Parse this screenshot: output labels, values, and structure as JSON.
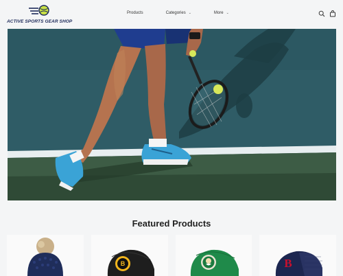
{
  "header": {
    "logo_text": "ACTIVE SPORTS GEAR SHOP",
    "nav": [
      {
        "label": "Products",
        "has_dropdown": false
      },
      {
        "label": "Categories",
        "has_dropdown": true
      },
      {
        "label": "More",
        "has_dropdown": true
      }
    ],
    "icons": [
      "search-icon",
      "cart-icon"
    ]
  },
  "hero": {
    "image": "tennis-player-legs-with-racket-and-ball"
  },
  "featured": {
    "title": "Featured Products",
    "products": [
      {
        "image": "navy-pom-pom-beanie"
      },
      {
        "image": "black-boston-bruins-cap"
      },
      {
        "image": "green-boston-celtics-cap"
      },
      {
        "image": "navy-boston-red-sox-cap"
      }
    ]
  },
  "colors": {
    "background": "#f4f5f6",
    "brand_navy": "#1d2a5a",
    "court_blue": "#2e5a62",
    "court_green": "#3a5a40",
    "ball_green": "#c8e045"
  }
}
